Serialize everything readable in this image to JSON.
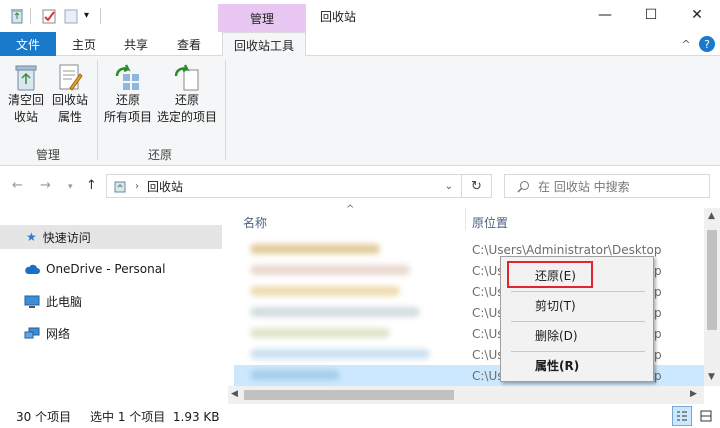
{
  "titlebar": {
    "context_tab": "管理",
    "title": "回收站",
    "minimize": "—",
    "maximize": "☐",
    "close": "✕"
  },
  "tabs": {
    "file": "文件",
    "home": "主页",
    "share": "共享",
    "view": "查看",
    "tools": "回收站工具",
    "collapse": "^",
    "help": "?"
  },
  "ribbon": {
    "empty_bin": "清空回\n收站",
    "properties": "回收站\n属性",
    "manage_group": "管理",
    "restore_all": "还原\n所有项目",
    "restore_selected": "还原\n选定的项目",
    "restore_group": "还原"
  },
  "address": {
    "location": "回收站",
    "search_placeholder": "在 回收站 中搜索"
  },
  "nav": {
    "quick_access": "快速访问",
    "onedrive": "OneDrive - Personal",
    "this_pc": "此电脑",
    "network": "网络"
  },
  "list": {
    "col_name": "名称",
    "col_location": "原位置",
    "rows": [
      {
        "location": "C:\\Users\\Administrator\\Desktop"
      },
      {
        "location": "C:\\Us"
      },
      {
        "location": "C:\\Us"
      },
      {
        "location": "C:\\Us"
      },
      {
        "location": "C:\\Us"
      },
      {
        "location": "C:\\Us"
      },
      {
        "location": "C:\\Us"
      }
    ]
  },
  "context_menu": {
    "restore": "还原(E)",
    "cut": "剪切(T)",
    "delete": "删除(D)",
    "properties": "属性(R)"
  },
  "status": {
    "item_count": "30 个项目",
    "selection": "选中 1 个项目  1.93 KB"
  },
  "colors": {
    "file_tab": "#1979ca",
    "context_tab": "#e8c8f2",
    "selection": "#cce8ff",
    "highlight_box": "#e0262b"
  }
}
